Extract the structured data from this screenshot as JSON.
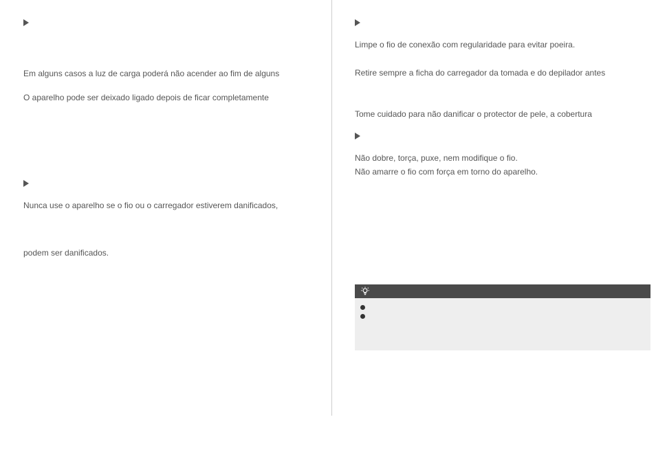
{
  "left": {
    "p1": "Em alguns casos a luz de carga poderá não acender ao fim de alguns",
    "p2": "O aparelho pode ser deixado ligado depois de ficar completamente",
    "p3": "Nunca use o aparelho se o fio ou o carregador estiverem danificados,",
    "p4": "podem ser danificados."
  },
  "right": {
    "p1": "Limpe o fio de conexão com regularidade para evitar poeira.",
    "p2": "Retire sempre a ficha do carregador da tomada e do depilador antes",
    "p3": "Tome cuidado para não danificar o protector de pele, a cobertura",
    "p4": "Não dobre, torça, puxe, nem modifique o fio.",
    "p5": "Não amarre o fio com força em torno do aparelho."
  }
}
